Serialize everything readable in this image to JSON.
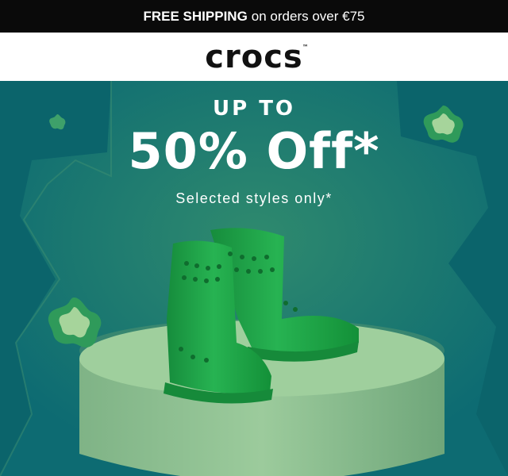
{
  "promo_bar": {
    "bold": "FREE SHIPPING",
    "text": "on orders over €75"
  },
  "brand": {
    "logo_text": "crocs",
    "trademark": "™"
  },
  "hero": {
    "line1": "UP TO",
    "line2": "50% Off*",
    "line3": "Selected styles only*"
  },
  "colors": {
    "promo_bg": "#0a0a0a",
    "hero_bg": "#0d6b72",
    "boot_green": "#1fa34a",
    "pedestal": "#8cbd8f"
  },
  "icons": [
    "flower-icon"
  ]
}
